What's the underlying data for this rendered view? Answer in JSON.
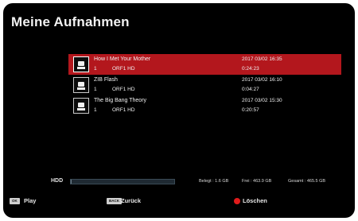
{
  "screen": {
    "title": "Meine Aufnahmen"
  },
  "recordings": [
    {
      "name": "How I Met Your Mother",
      "num": "1",
      "channel": "ORF1 HD",
      "date": "2017 03/02 16:35",
      "duration": "0:24:23",
      "selected": true
    },
    {
      "name": "ZIB Flash",
      "num": "1",
      "channel": "ORF1 HD",
      "date": "2017 03/02 16:10",
      "duration": "0:04:27",
      "selected": false
    },
    {
      "name": "The Big Bang Theory",
      "num": "1",
      "channel": "ORF1 HD",
      "date": "2017 03/02 15:30",
      "duration": "0:20:57",
      "selected": false
    }
  ],
  "storage": {
    "label": "HDD",
    "used_fraction": 0.0034,
    "used": "Belegt : 1.6 GB",
    "free": "Frei : 463.9 GB",
    "total": "Gesamt : 465.5 GB"
  },
  "footer": {
    "ok_key": "OK",
    "play_label": "Play",
    "back_key": "BACK",
    "back_label": "Zurück",
    "delete_label": "Löschen"
  },
  "colors": {
    "selection": "#b3171d",
    "delete_dot": "#e01b1b",
    "background": "#000000"
  },
  "icons": [
    "record-icon",
    "red-button-icon"
  ]
}
